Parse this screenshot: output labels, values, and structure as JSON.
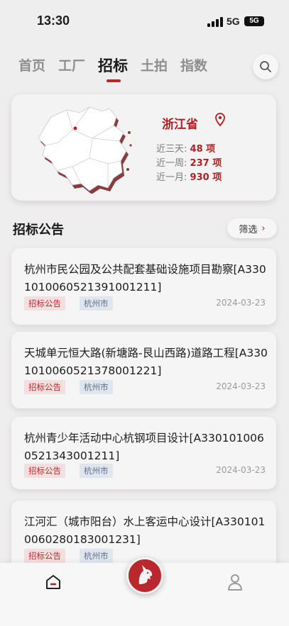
{
  "status": {
    "time": "13:30",
    "network": "5G",
    "battery": "5G"
  },
  "tabs": [
    {
      "label": "首页"
    },
    {
      "label": "工厂"
    },
    {
      "label": "招标"
    },
    {
      "label": "土拍"
    },
    {
      "label": "指数"
    }
  ],
  "active_tab": "招标",
  "province": {
    "name": "浙江省",
    "stats": [
      {
        "label": "近三天:",
        "value": "48 项"
      },
      {
        "label": "近一周:",
        "value": "237 项"
      },
      {
        "label": "近一月:",
        "value": "930 项"
      }
    ]
  },
  "section": {
    "title": "招标公告",
    "filter_label": "筛选"
  },
  "notices": [
    {
      "title": "杭州市民公园及公共配套基础设施项目勘察[A330101006052139100121​1]",
      "tags": [
        "招标公告",
        "杭州市"
      ],
      "date": "2024-03-23"
    },
    {
      "title": "天城单元恒大路(新塘路-艮山西路)道路工程[A33010100605213780012​21]",
      "tags": [
        "招标公告",
        "杭州市"
      ],
      "date": "2024-03-23"
    },
    {
      "title": "杭州青少年活动中心杭钢项目设计[A3301010060521343001211]",
      "tags": [
        "招标公告",
        "杭州市"
      ],
      "date": "2024-03-23"
    },
    {
      "title": "江河汇（城市阳台）水上客运中心设计[A3301010060280183001231]",
      "tags": [
        "招标公告",
        "杭州市"
      ],
      "date": ""
    }
  ],
  "colors": {
    "brand": "#b01f24",
    "background": "#efeeee"
  },
  "icons": {
    "search": "search-icon",
    "location": "location-pin-icon",
    "home": "home-icon",
    "center": "unicorn-logo-icon",
    "user": "user-icon"
  }
}
